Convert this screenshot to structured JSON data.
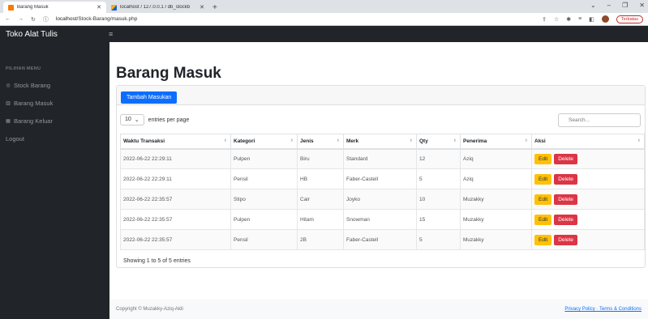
{
  "browser": {
    "tabs": [
      {
        "title": "Barang Masuk",
        "active": true
      },
      {
        "title": "localhost / 127.0.0.1 / db_stockb",
        "active": false
      }
    ],
    "url_prefix": "localhost",
    "url_path": "/Stock-Barang/masuk.php",
    "profile_status": "Terbatas"
  },
  "brand": "Toko Alat Tulis",
  "sidebar": {
    "heading": "PILIHAN MENU",
    "items": [
      {
        "label": "Stock Barang",
        "icon": "tachometer-icon"
      },
      {
        "label": "Barang Masuk",
        "icon": "chart-icon"
      },
      {
        "label": "Barang Keluar",
        "icon": "table-icon"
      },
      {
        "label": "Logout",
        "icon": ""
      }
    ]
  },
  "page_title": "Barang Masuk",
  "add_button": "Tambah Masukan",
  "entries": {
    "value": "10",
    "label": "entries per page"
  },
  "search_placeholder": "Search...",
  "table": {
    "headers": [
      "Waktu Transaksi",
      "Kategori",
      "Jenis",
      "Merk",
      "Qty",
      "Penerima",
      "Aksi"
    ],
    "rows": [
      [
        "2022-06-22 22:29:11",
        "Pulpen",
        "Biru",
        "Standard",
        "12",
        "Aziq"
      ],
      [
        "2022-06-22 22:29:11",
        "Pensil",
        "HB",
        "Faber-Castell",
        "5",
        "Aziq"
      ],
      [
        "2022-06-22 22:35:57",
        "Stipo",
        "Cair",
        "Joyko",
        "10",
        "Muzakky"
      ],
      [
        "2022-06-22 22:35:57",
        "Pulpen",
        "Hitam",
        "Snowman",
        "15",
        "Muzakky"
      ],
      [
        "2022-06-22 22:35:57",
        "Pensil",
        "2B",
        "Faber-Castell",
        "5",
        "Muzakky"
      ]
    ],
    "edit_label": "Edit",
    "delete_label": "Delete"
  },
  "table_info": "Showing 1 to 5 of 5 entries",
  "footer": {
    "copyright": "Copyright © Muzakky-Aziq-Aldi",
    "links": "Privacy Policy · Terms & Conditions"
  }
}
